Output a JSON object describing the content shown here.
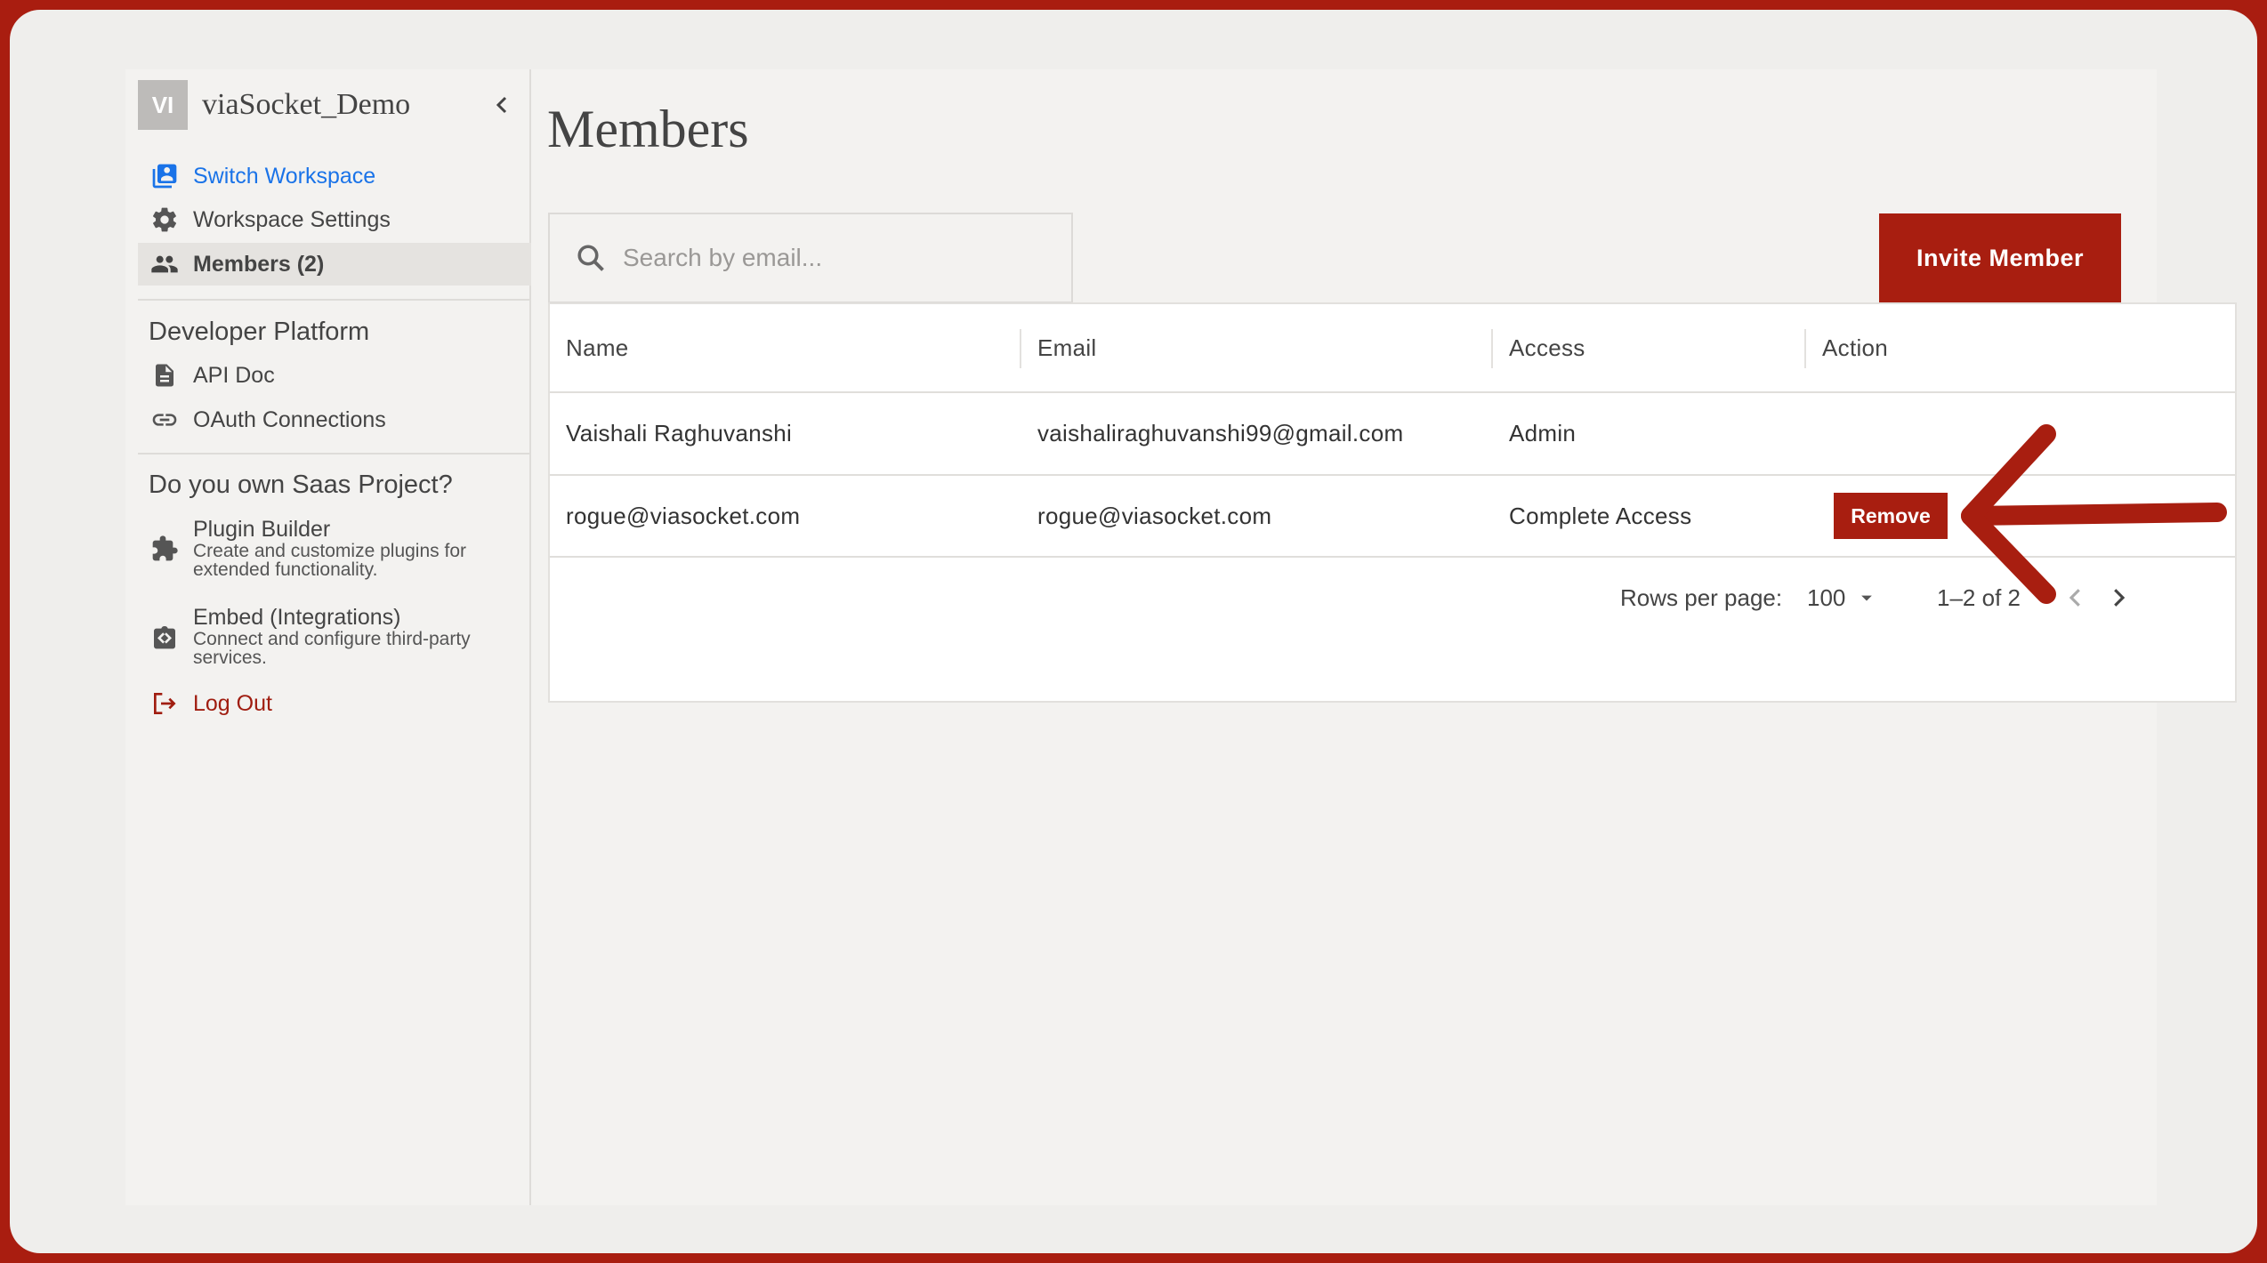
{
  "workspace": {
    "initials": "VI",
    "name": "viaSocket_Demo"
  },
  "sidebar": {
    "items": [
      {
        "label": "Switch Workspace",
        "icon": "switch-workspace-icon"
      },
      {
        "label": "Workspace Settings",
        "icon": "gear-icon"
      },
      {
        "label": "Members (2)",
        "icon": "people-icon"
      }
    ],
    "developer_platform": {
      "title": "Developer Platform",
      "items": [
        {
          "label": "API Doc",
          "icon": "document-icon"
        },
        {
          "label": "OAuth Connections",
          "icon": "link-icon"
        }
      ]
    },
    "saas": {
      "title": "Do you own Saas Project?",
      "items": [
        {
          "title": "Plugin Builder",
          "description": "Create and customize plugins for extended functionality.",
          "icon": "puzzle-icon"
        },
        {
          "title": "Embed (Integrations)",
          "description": "Connect and configure third-party services.",
          "icon": "embed-icon"
        }
      ]
    },
    "logout": {
      "label": "Log Out",
      "icon": "logout-icon"
    }
  },
  "main": {
    "title": "Members",
    "search": {
      "placeholder": "Search by email...",
      "value": ""
    },
    "invite_label": "Invite Member",
    "table": {
      "headers": [
        "Name",
        "Email",
        "Access",
        "Action"
      ],
      "rows": [
        {
          "name": "Vaishali Raghuvanshi",
          "email": "vaishaliraghuvanshi99@gmail.com",
          "access": "Admin",
          "action": ""
        },
        {
          "name": "rogue@viasocket.com",
          "email": "rogue@viasocket.com",
          "access": "Complete Access",
          "action": "Remove"
        }
      ],
      "pagination": {
        "rows_per_page_label": "Rows per page:",
        "rows_per_page": "100",
        "range": "1–2 of 2"
      }
    }
  },
  "colors": {
    "accent": "#a81e10",
    "link": "#1a73e8",
    "frame": "#a91d10"
  }
}
